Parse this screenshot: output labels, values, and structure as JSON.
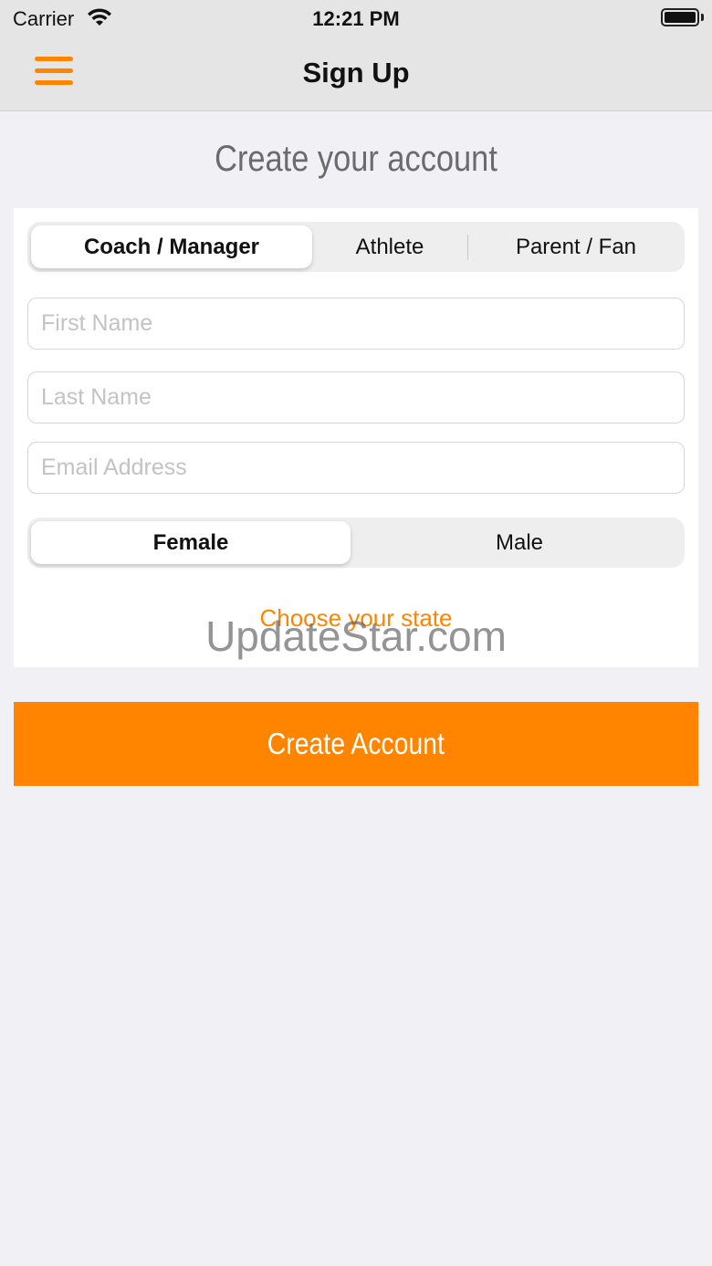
{
  "status_bar": {
    "carrier": "Carrier",
    "time": "12:21 PM",
    "wifi_icon": "wifi-icon",
    "battery_icon": "battery-icon"
  },
  "nav": {
    "title": "Sign Up",
    "menu_icon": "hamburger-menu-icon",
    "accent_color": "#ff8500"
  },
  "heading": "Create your account",
  "role_selector": {
    "options": [
      "Coach / Manager",
      "Athlete",
      "Parent / Fan"
    ],
    "selected": "Coach / Manager"
  },
  "fields": {
    "first_name_placeholder": "First Name",
    "last_name_placeholder": "Last Name",
    "email_placeholder": "Email Address"
  },
  "gender_selector": {
    "options": [
      "Female",
      "Male"
    ],
    "selected": "Female"
  },
  "state_link": "Choose your state",
  "watermark": "UpdateStar.com",
  "create_button": "Create Account",
  "colors": {
    "accent": "#ff8500",
    "background": "#f0f0f5",
    "bar": "#e5e5e5"
  }
}
